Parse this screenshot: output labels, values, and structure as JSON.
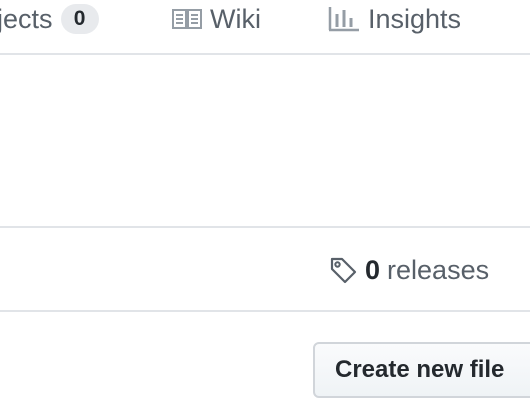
{
  "repo_nav": {
    "projects": {
      "label": "jects",
      "count": "0"
    },
    "wiki": {
      "label": "Wiki",
      "icon": "book-icon"
    },
    "insights": {
      "label": "Insights",
      "icon": "graph-icon"
    }
  },
  "summary": {
    "releases": {
      "count": "0",
      "label": "releases",
      "icon": "tag-icon"
    }
  },
  "file_navigation": {
    "create_new_file_label": "Create new file"
  },
  "colors": {
    "text_muted": "#586069",
    "text_default": "#24292e",
    "border": "#e1e4e8",
    "counter_bg": "#e8eaed"
  }
}
